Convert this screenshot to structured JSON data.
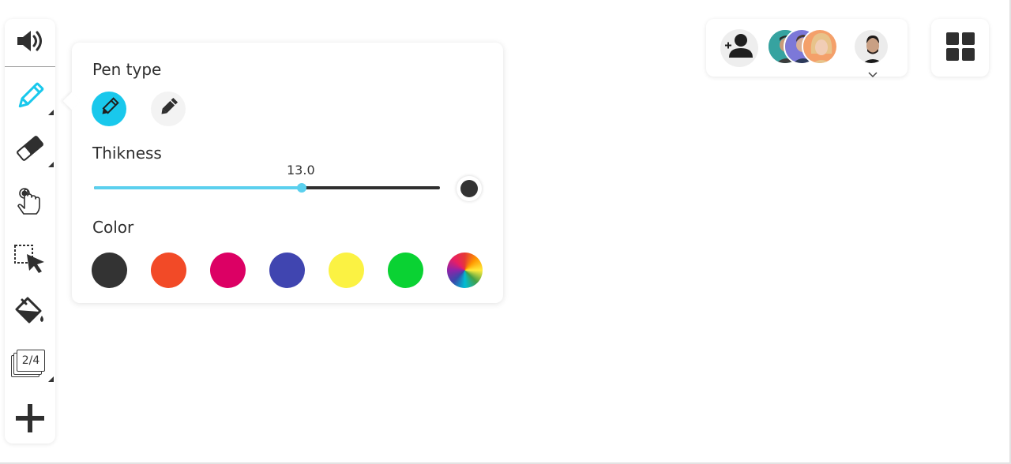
{
  "toolbar": {
    "tools": [
      {
        "name": "speaker-icon"
      },
      {
        "name": "pencil-icon",
        "active": true
      },
      {
        "name": "eraser-icon"
      },
      {
        "name": "hand-pointer-icon"
      },
      {
        "name": "selection-arrow-icon"
      },
      {
        "name": "paint-bucket-icon"
      },
      {
        "name": "pages-icon"
      },
      {
        "name": "plus-icon"
      }
    ],
    "page_counter": "2/4",
    "active_color": "#19c8ec"
  },
  "pen_panel": {
    "pen_type_label": "Pen type",
    "pen_types": [
      "pencil",
      "pen"
    ],
    "active_pen": "pencil",
    "thickness_label": "Thikness",
    "thickness_value": "13.0",
    "thickness_fraction": 0.6,
    "color_label": "Color",
    "colors": [
      "#333333",
      "#f24a27",
      "#dc0064",
      "#4045b0",
      "#fbf243",
      "#0ad233",
      "rainbow"
    ]
  },
  "users": {
    "avatar_count": 4
  }
}
